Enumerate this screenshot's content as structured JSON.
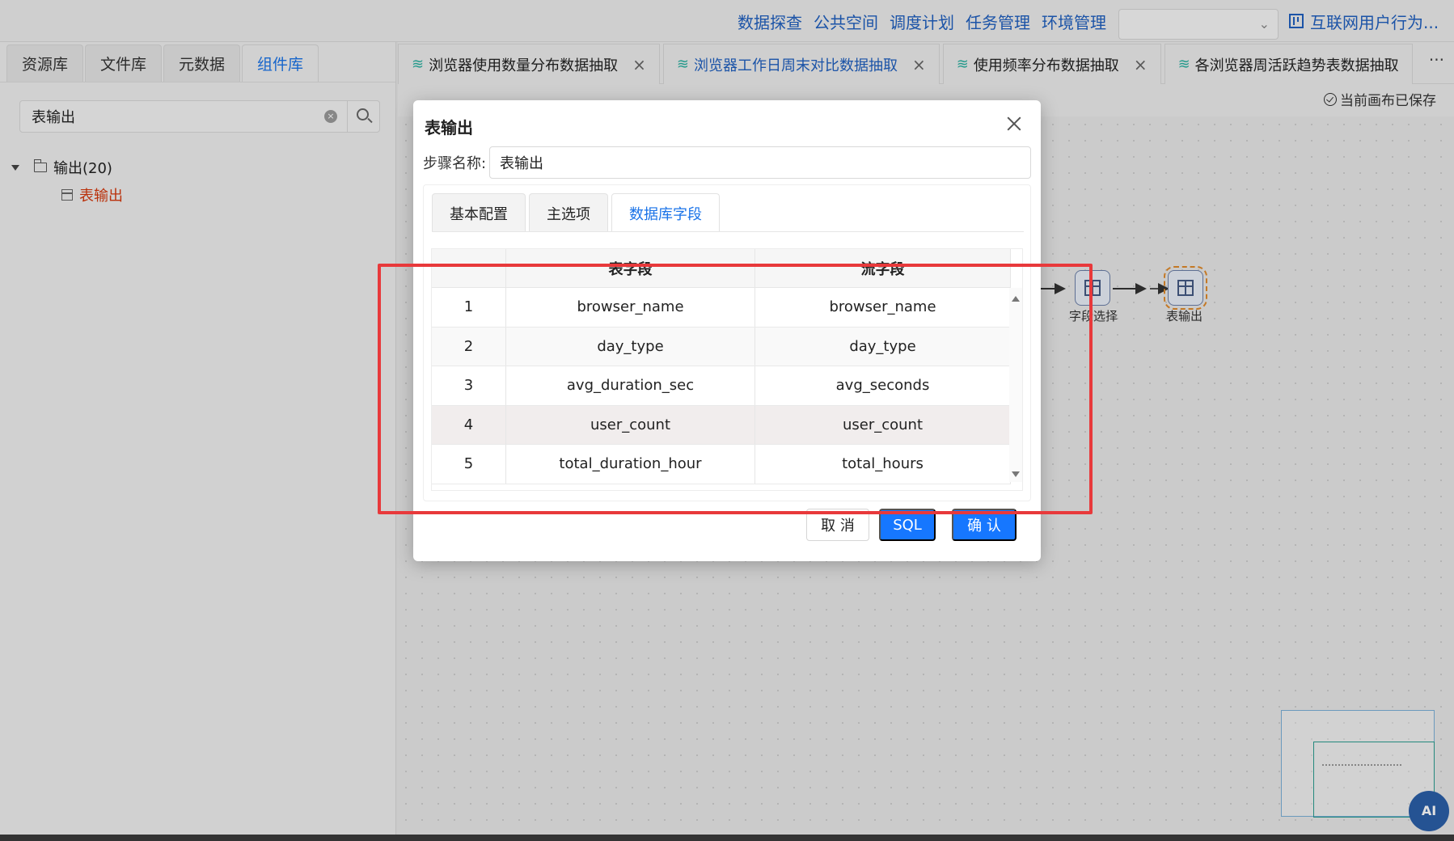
{
  "topnav": {
    "menu": [
      "数据探查",
      "公共空间",
      "调度计划",
      "任务管理",
      "环境管理"
    ],
    "project_label": "互联网用户行为..."
  },
  "left_panel": {
    "tabs": [
      "资源库",
      "文件库",
      "元数据",
      "组件库"
    ],
    "active_tab": "组件库",
    "search_value": "表输出",
    "tree": {
      "folder_label": "输出(20)",
      "leaf_label": "表输出"
    }
  },
  "editor_tabs": [
    {
      "label": "浏览器使用数量分布数据抽取"
    },
    {
      "label": "浏览器工作日周末对比数据抽取",
      "active": true
    },
    {
      "label": "使用频率分布数据抽取"
    },
    {
      "label": "各浏览器周活跃趋势表数据抽取"
    }
  ],
  "editor": {
    "more": "···",
    "saved_status": "当前画布已保存"
  },
  "canvas": {
    "nodes": [
      {
        "label": "字段选择"
      },
      {
        "label": "表输出"
      }
    ]
  },
  "ai_button": "AI",
  "modal": {
    "title": "表输出",
    "step_name_label": "步骤名称:",
    "step_name_value": "表输出",
    "tabs": [
      "基本配置",
      "主选项",
      "数据库字段"
    ],
    "active_tab": "数据库字段",
    "table": {
      "headers": [
        "",
        "表字段",
        "流字段"
      ],
      "rows": [
        [
          "1",
          "browser_name",
          "browser_name"
        ],
        [
          "2",
          "day_type",
          "day_type"
        ],
        [
          "3",
          "avg_duration_sec",
          "avg_seconds"
        ],
        [
          "4",
          "user_count",
          "user_count"
        ],
        [
          "5",
          "total_duration_hour",
          "total_hours"
        ]
      ]
    },
    "buttons": {
      "cancel": "取 消",
      "sql": "SQL",
      "confirm": "确 认"
    }
  },
  "colors": {
    "accent": "#1677ff",
    "highlight_box": "#e8393b",
    "tree_leaf": "#d4380d"
  }
}
